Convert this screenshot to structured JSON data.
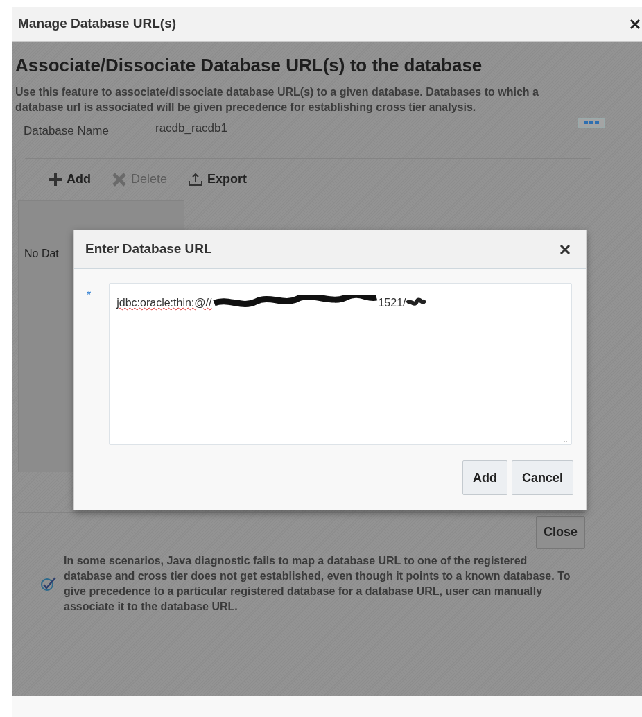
{
  "dialog": {
    "title": "Manage Database URL(s)",
    "heading": "Associate/Dissociate Database URL(s) to the database",
    "description": "Use this feature to associate/dissociate database URL(s) to a given database. Databases to which a database url is associated will be given precedence for establishing cross tier analysis.",
    "database_name": {
      "label": "Database Name",
      "value": "racdb_racdb1"
    },
    "toolbar": [
      {
        "label": "Add",
        "disabled": false,
        "kind": "add"
      },
      {
        "label": "Delete",
        "disabled": true,
        "kind": "delete"
      },
      {
        "label": "Export",
        "disabled": false,
        "kind": "export"
      }
    ],
    "table": {
      "empty_text": "No Dat"
    },
    "buttons": [
      "Close"
    ],
    "note": "In some scenarios, Java diagnostic fails to map a database URL to one of the registered database and cross tier does not get established, even though it points to a known database. To give precedence to a particular registered database for a database URL, user can manually associate it to the database URL."
  },
  "modal": {
    "title": "Enter Database URL",
    "required_mark": "*",
    "url_prefix": "jdbc:oracle:thin:@//",
    "url_suffix": "1521/",
    "buttons": [
      "Add",
      "Cancel"
    ]
  }
}
